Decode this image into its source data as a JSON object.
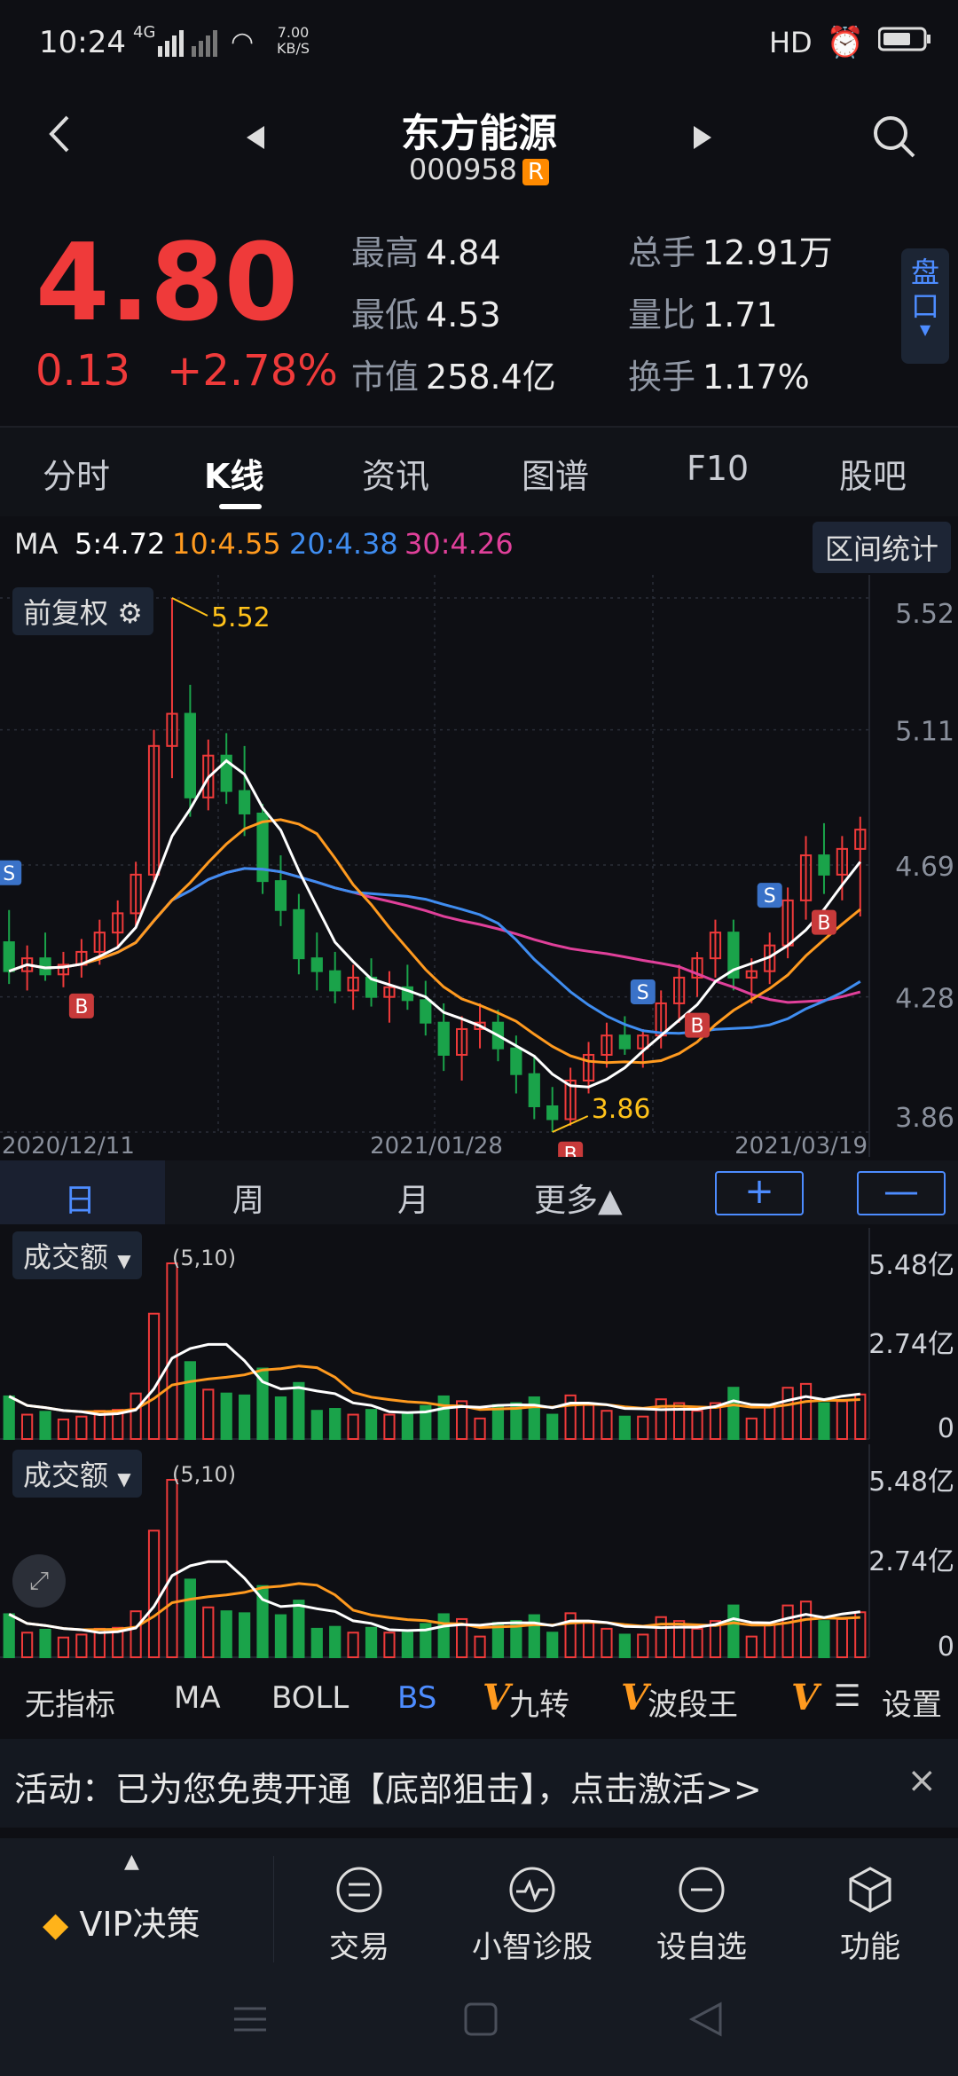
{
  "status": {
    "time": "10:24",
    "network": "4G",
    "speed_value": "7.00",
    "speed_unit": "KB/S",
    "right": "HD"
  },
  "header": {
    "title": "东方能源",
    "code": "000958",
    "badge": "R"
  },
  "quote": {
    "price": "4.80",
    "change": "0.13",
    "change_pct": "+2.78%",
    "high_label": "最高",
    "high": "4.84",
    "low_label": "最低",
    "low": "4.53",
    "mcap_label": "市值",
    "mcap": "258.4亿",
    "vol_label": "总手",
    "vol": "12.91万",
    "ratio_label": "量比",
    "ratio": "1.71",
    "turnover_label": "换手",
    "turnover": "1.17%",
    "pankou": "盘口"
  },
  "tabs": [
    "分时",
    "K线",
    "资讯",
    "图谱",
    "F10",
    "股吧"
  ],
  "ma": {
    "label": "MA",
    "ma5": "5:4.72",
    "ma10": "10:4.55",
    "ma20": "20:4.38",
    "ma30": "30:4.26",
    "range_btn": "区间统计"
  },
  "kline": {
    "fq_label": "前复权",
    "high_mark": "5.52",
    "low_mark": "3.86",
    "y_labels": [
      "5.52",
      "5.11",
      "4.69",
      "4.28",
      "3.86"
    ],
    "dates": [
      "2020/12/11",
      "2021/01/28",
      "2021/03/19"
    ],
    "markers": [
      "S",
      "S",
      "S",
      "S",
      "B",
      "B",
      "B",
      "B"
    ]
  },
  "period": {
    "tabs": [
      "日",
      "周",
      "月",
      "更多▲"
    ],
    "plus": "+",
    "minus": "—"
  },
  "volume1": {
    "label": "成交额",
    "params": "(5,10)",
    "y_labels": [
      "5.48亿",
      "2.74亿",
      "0"
    ]
  },
  "volume2": {
    "label": "成交额",
    "params": "(5,10)",
    "y_labels": [
      "5.48亿",
      "2.74亿",
      "0"
    ]
  },
  "indicators": [
    "无指标",
    "MA",
    "BOLL",
    "BS",
    "九转",
    "波段王",
    "设置"
  ],
  "indicator_v": "V",
  "activity": {
    "text": "活动：已为您免费开通【底部狙击】，点击激活>>",
    "close": "×"
  },
  "bottom_nav": [
    "VIP决策",
    "交易",
    "小智诊股",
    "设自选",
    "功能"
  ],
  "colors": {
    "up": "#ef3a3a",
    "down": "#1aa34a",
    "ma5": "#ffffff",
    "ma10": "#ff9a1f",
    "ma20": "#3f8df0",
    "ma30": "#e0409a",
    "accent": "#4d8cff"
  },
  "chart_data": {
    "type": "candlestick",
    "x": [
      "2020/12/11",
      "2021/01/28",
      "2021/03/19"
    ],
    "ohlc": [
      [
        4.45,
        4.55,
        4.32,
        4.36
      ],
      [
        4.36,
        4.44,
        4.3,
        4.4
      ],
      [
        4.4,
        4.48,
        4.33,
        4.35
      ],
      [
        4.35,
        4.42,
        4.31,
        4.38
      ],
      [
        4.38,
        4.46,
        4.34,
        4.42
      ],
      [
        4.42,
        4.52,
        4.38,
        4.48
      ],
      [
        4.48,
        4.58,
        4.43,
        4.54
      ],
      [
        4.54,
        4.7,
        4.5,
        4.66
      ],
      [
        4.66,
        5.11,
        4.64,
        5.06
      ],
      [
        5.06,
        5.52,
        4.96,
        5.16
      ],
      [
        5.16,
        5.25,
        4.84,
        4.9
      ],
      [
        4.9,
        5.08,
        4.86,
        5.03
      ],
      [
        5.03,
        5.1,
        4.88,
        4.92
      ],
      [
        4.92,
        5.06,
        4.78,
        4.85
      ],
      [
        4.85,
        4.88,
        4.6,
        4.64
      ],
      [
        4.64,
        4.72,
        4.5,
        4.55
      ],
      [
        4.55,
        4.6,
        4.35,
        4.4
      ],
      [
        4.4,
        4.48,
        4.3,
        4.36
      ],
      [
        4.36,
        4.42,
        4.26,
        4.3
      ],
      [
        4.3,
        4.38,
        4.24,
        4.34
      ],
      [
        4.34,
        4.4,
        4.25,
        4.28
      ],
      [
        4.28,
        4.36,
        4.2,
        4.31
      ],
      [
        4.31,
        4.38,
        4.24,
        4.27
      ],
      [
        4.27,
        4.33,
        4.16,
        4.2
      ],
      [
        4.2,
        4.26,
        4.05,
        4.1
      ],
      [
        4.1,
        4.22,
        4.02,
        4.18
      ],
      [
        4.18,
        4.26,
        4.12,
        4.2
      ],
      [
        4.2,
        4.24,
        4.08,
        4.12
      ],
      [
        4.12,
        4.16,
        3.98,
        4.04
      ],
      [
        4.04,
        4.1,
        3.9,
        3.94
      ],
      [
        3.94,
        4.0,
        3.86,
        3.9
      ],
      [
        3.9,
        4.06,
        3.88,
        4.02
      ],
      [
        4.02,
        4.14,
        3.98,
        4.1
      ],
      [
        4.1,
        4.2,
        4.06,
        4.16
      ],
      [
        4.16,
        4.22,
        4.1,
        4.12
      ],
      [
        4.12,
        4.18,
        4.06,
        4.16
      ],
      [
        4.16,
        4.3,
        4.12,
        4.26
      ],
      [
        4.26,
        4.38,
        4.2,
        4.34
      ],
      [
        4.34,
        4.42,
        4.28,
        4.4
      ],
      [
        4.4,
        4.52,
        4.34,
        4.48
      ],
      [
        4.48,
        4.52,
        4.3,
        4.34
      ],
      [
        4.34,
        4.4,
        4.26,
        4.36
      ],
      [
        4.36,
        4.48,
        4.32,
        4.44
      ],
      [
        4.44,
        4.62,
        4.4,
        4.58
      ],
      [
        4.58,
        4.78,
        4.52,
        4.72
      ],
      [
        4.72,
        4.82,
        4.6,
        4.66
      ],
      [
        4.66,
        4.78,
        4.58,
        4.74
      ],
      [
        4.74,
        4.84,
        4.53,
        4.8
      ]
    ],
    "ylim": [
      3.86,
      5.52
    ]
  }
}
